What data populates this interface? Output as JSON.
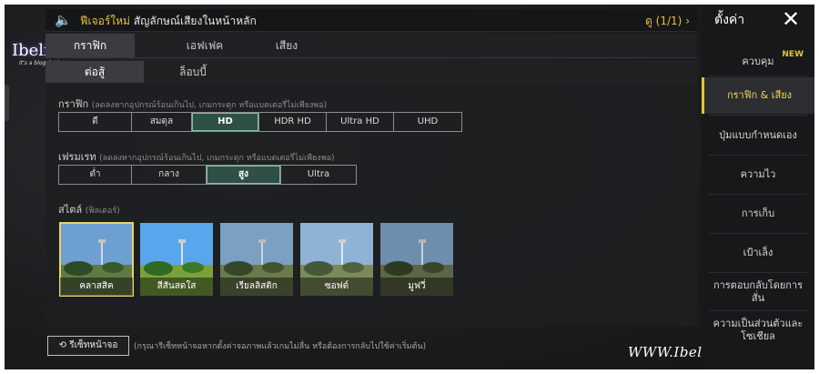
{
  "topbar": {
    "notice_prefix": "ฟีเจอร์ใหม่",
    "notice_text": "สัญลักษณ์เสียงในหน้าหลัก",
    "page_indicator": "ดู (1/1)",
    "chevron": "›"
  },
  "tabs_main": [
    "กราฟิก",
    "เอฟเฟค",
    "เสียง"
  ],
  "tabs_sub": [
    "ต่อสู้",
    "ล็อบบี้"
  ],
  "graphics": {
    "label": "กราฟิก",
    "hint": "(ลดลงหากอุปกรณ์ร้อนเกินไป, เกมกระตุก หรือแบตเตอรี่ไม่เพียงพอ)",
    "options": [
      "ดี",
      "สมดุล",
      "HD",
      "HDR HD",
      "Ultra HD",
      "UHD"
    ],
    "selected": "HD"
  },
  "framerate": {
    "label": "เฟรมเรท",
    "hint": "(ลดลงหากอุปกรณ์ร้อนเกินไป, เกมกระตุก หรือแบตเตอรี่ไม่เพียงพอ)",
    "options": [
      "ต่ำ",
      "กลาง",
      "สูง",
      "Ultra"
    ],
    "selected": "สูง"
  },
  "style": {
    "label": "สไตล์",
    "hint": "(ฟิลเตอร์)",
    "options": [
      "คลาสสิค",
      "สีสันสดใส",
      "เรียลลิสติก",
      "ซอฟต์",
      "มูฟวี่"
    ],
    "selected": "คลาสสิค"
  },
  "reset": {
    "label": "รีเซ็ทหน้าจอ",
    "hint": "(กรุณารีเซ็ทหน้าจอหากตั้งค่าจอภาพแล้วเกมไม่ลื่น หรือต้องการกลับไปใช้ค่าเริ่มต้น)"
  },
  "sidebar": {
    "title": "ตั้งค่า",
    "close": "✕",
    "new_badge": "NEW",
    "items": [
      "ควบคุม",
      "กราฟิก & เสียง",
      "ปุ่มแบบกำหนดเอง",
      "ความไว",
      "การเก็บ",
      "เป้าเล็ง",
      "การตอบกลับโดยการสั่น",
      "ความเป็นส่วนตัวและโซเชียล"
    ]
  },
  "logo": {
    "name": "IbelieveIT",
    "sub": "It's a blog & Ideas"
  },
  "watermark": "WWW.IbelieveIT.Net",
  "colors": {
    "accent": "#e7c23b",
    "selected": "#2f4f47"
  }
}
